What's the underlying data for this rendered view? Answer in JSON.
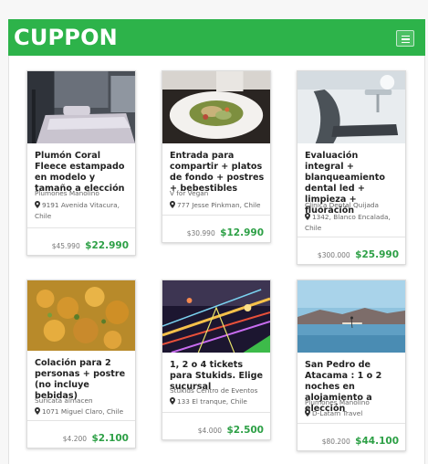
{
  "header": {
    "brand": "CUPPON",
    "menu_icon": "hamburger-menu-icon",
    "brand_color": "#2db34a"
  },
  "deals": [
    {
      "title": "Plumón Coral Fleece estampado en modelo y tamaño a elección",
      "vendor": "Plumones Manolino",
      "address": "9191 Avenida Vitacura, Chile",
      "old_price": "$45.990",
      "new_price": "$22.990"
    },
    {
      "title": "Entrada para compartir + platos de fondo + postres + bebestibles",
      "vendor": "V for Vegan",
      "address": "777 Jesse Pinkman, Chile",
      "old_price": "$30.990",
      "new_price": "$12.990"
    },
    {
      "title": "Evaluación integral + blanqueamiento dental led + limpieza + fluoración",
      "vendor": "Clínica Dental Quijada",
      "address": "1342, Blanco Encalada, Chile",
      "old_price": "$300.000",
      "new_price": "$25.990"
    },
    {
      "title": "Colación para 2 personas + postre (no incluye bebidas)",
      "vendor": "Suricata almacen",
      "address": "1071 Miguel Claro, Chile",
      "old_price": "$4.200",
      "new_price": "$2.100"
    },
    {
      "title": "1, 2 o 4 tickets para Stukids. Elige sucursal",
      "vendor": "Stukids Centro de Eventos",
      "address": "133 El tranque, Chile",
      "old_price": "$4.000",
      "new_price": "$2.500"
    },
    {
      "title": "San Pedro de Atacama : 1 o 2 noches en alojamiento a elección",
      "vendor": "Plumones Manolino",
      "address": "D-Latam Travel",
      "old_price": "$80.200",
      "new_price": "$44.100"
    }
  ]
}
